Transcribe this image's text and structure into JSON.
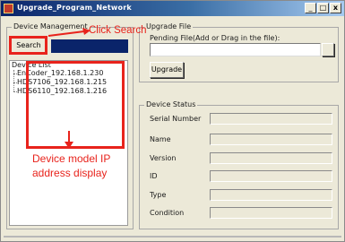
{
  "window": {
    "title": "Upgrade_Program_Network",
    "controls": {
      "minimize": "_",
      "maximize": "□",
      "close": "x"
    }
  },
  "device_management": {
    "title": "Device Management",
    "search_label": "Search",
    "list_title": "Device List",
    "devices": [
      {
        "label": "EnCoder_192.168.1.230"
      },
      {
        "label": "HDS7106_192.168.1.215"
      },
      {
        "label": "HDS6110_192.168.1.216"
      }
    ]
  },
  "upgrade_file": {
    "title": "Upgrade File",
    "pending_label": "Pending File(Add or Drag in the file):",
    "file_value": "",
    "upgrade_label": "Upgrade"
  },
  "device_status": {
    "title": "Device Status",
    "fields": [
      {
        "label": "Serial Number",
        "value": ""
      },
      {
        "label": "Name",
        "value": ""
      },
      {
        "label": "Version",
        "value": ""
      },
      {
        "label": "ID",
        "value": ""
      },
      {
        "label": "Type",
        "value": ""
      },
      {
        "label": "Condition",
        "value": ""
      }
    ]
  },
  "annotations": {
    "click_search": "Click Search",
    "model_ip_line1": "Device model IP",
    "model_ip_line2": "address display",
    "color": "#e8231c"
  }
}
